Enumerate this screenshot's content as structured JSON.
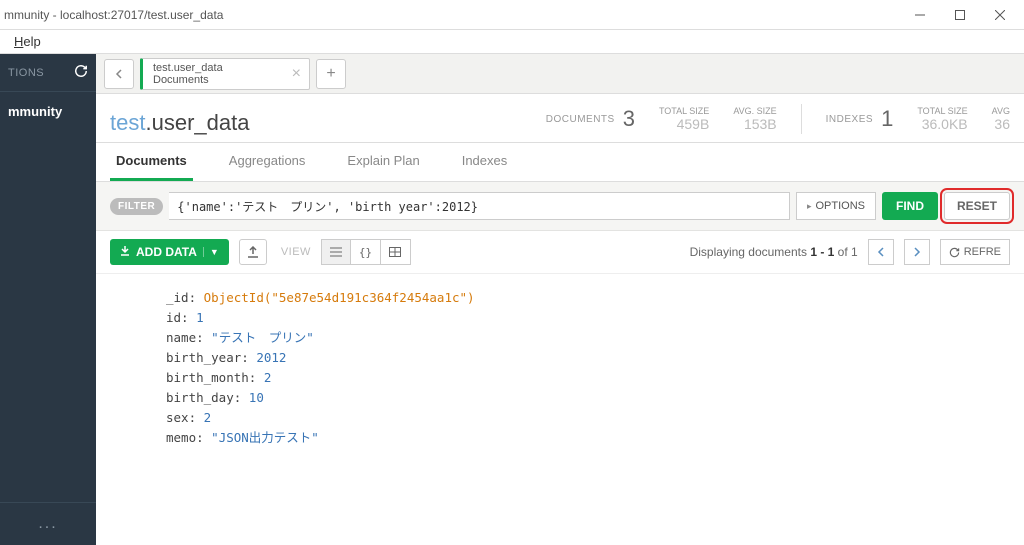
{
  "window": {
    "title": "mmunity - localhost:27017/test.user_data"
  },
  "menubar": {
    "help": "Help",
    "help_underline": "H"
  },
  "sidebar": {
    "top_label": "TIONS",
    "active_item": "mmunity",
    "bottom": "..."
  },
  "tab": {
    "line1": "test.user_data",
    "line2": "Documents"
  },
  "namespace": {
    "db": "test",
    "coll": "user_data"
  },
  "stats": {
    "documents_label": "DOCUMENTS",
    "documents_count": "3",
    "total_size_label": "TOTAL SIZE",
    "total_size": "459B",
    "avg_size_label": "AVG. SIZE",
    "avg_size": "153B",
    "indexes_label": "INDEXES",
    "indexes_count": "1",
    "idx_total_size_label": "TOTAL SIZE",
    "idx_total_size": "36.0KB",
    "idx_avg_label": "AVG",
    "idx_avg": "36"
  },
  "subtabs": {
    "documents": "Documents",
    "aggregations": "Aggregations",
    "explain": "Explain Plan",
    "indexes": "Indexes"
  },
  "filter": {
    "pill": "FILTER",
    "query_display": "{'name':'テスト　プリン', 'birth year':2012}",
    "options": "OPTIONS",
    "find": "FIND",
    "reset": "RESET"
  },
  "toolbar": {
    "add_data": "ADD DATA",
    "view_label": "VIEW",
    "paging_prefix": "Displaying documents ",
    "paging_range": "1 - 1",
    "paging_of": " of ",
    "paging_total": "1",
    "refresh": "REFRE"
  },
  "document": {
    "fields": [
      {
        "k": "_id",
        "type": "oid",
        "v": "ObjectId(\"5e87e54d191c364f2454aa1c\")"
      },
      {
        "k": "id",
        "type": "num",
        "v": "1"
      },
      {
        "k": "name",
        "type": "str",
        "v": "\"テスト　プリン\""
      },
      {
        "k": "birth_year",
        "type": "num",
        "v": "2012"
      },
      {
        "k": "birth_month",
        "type": "num",
        "v": "2"
      },
      {
        "k": "birth_day",
        "type": "num",
        "v": "10"
      },
      {
        "k": "sex",
        "type": "num",
        "v": "2"
      },
      {
        "k": "memo",
        "type": "str",
        "v": "\"JSON出力テスト\""
      }
    ]
  }
}
